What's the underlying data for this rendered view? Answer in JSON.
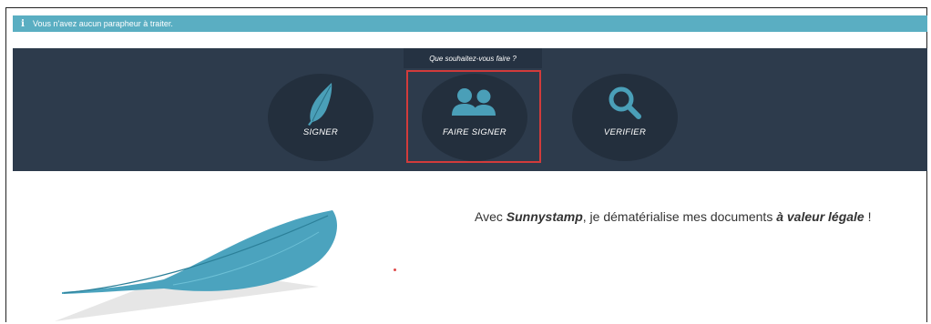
{
  "info_banner": {
    "icon": "info-icon",
    "text": "Vous n'avez aucun parapheur à traiter."
  },
  "action_panel": {
    "prompt": "Que souhaitez-vous faire ?",
    "actions": [
      {
        "label": "SIGNER",
        "icon": "feather-icon"
      },
      {
        "label": "FAIRE SIGNER",
        "icon": "users-icon",
        "highlighted": true
      },
      {
        "label": "VERIFIER",
        "icon": "magnifier-icon"
      }
    ]
  },
  "tagline": {
    "prefix": "Avec ",
    "brand": "Sunnystamp",
    "middle": ", je dématérialise mes documents ",
    "emphasis": "à valeur légale",
    "suffix": " !"
  },
  "colors": {
    "banner_bg": "#5aaec2",
    "panel_bg": "#2d3b4c",
    "circle_bg": "#232f3d",
    "accent": "#4a9fb8",
    "highlight": "#d23b3b"
  }
}
